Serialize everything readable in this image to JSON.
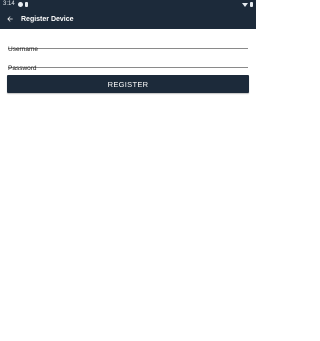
{
  "status_bar": {
    "time": "3:14",
    "icons": [
      "notification-icon",
      "lock-icon",
      "wifi-icon",
      "battery-icon"
    ]
  },
  "app_bar": {
    "title": "Register Device",
    "back_icon": "arrow-left-icon"
  },
  "form": {
    "username": {
      "placeholder": "Username",
      "value": ""
    },
    "password": {
      "placeholder": "Password",
      "value": ""
    },
    "register_label": "REGISTER"
  },
  "colors": {
    "primary": "#1c2a3a",
    "background": "#ffffff",
    "text": "#222222"
  }
}
